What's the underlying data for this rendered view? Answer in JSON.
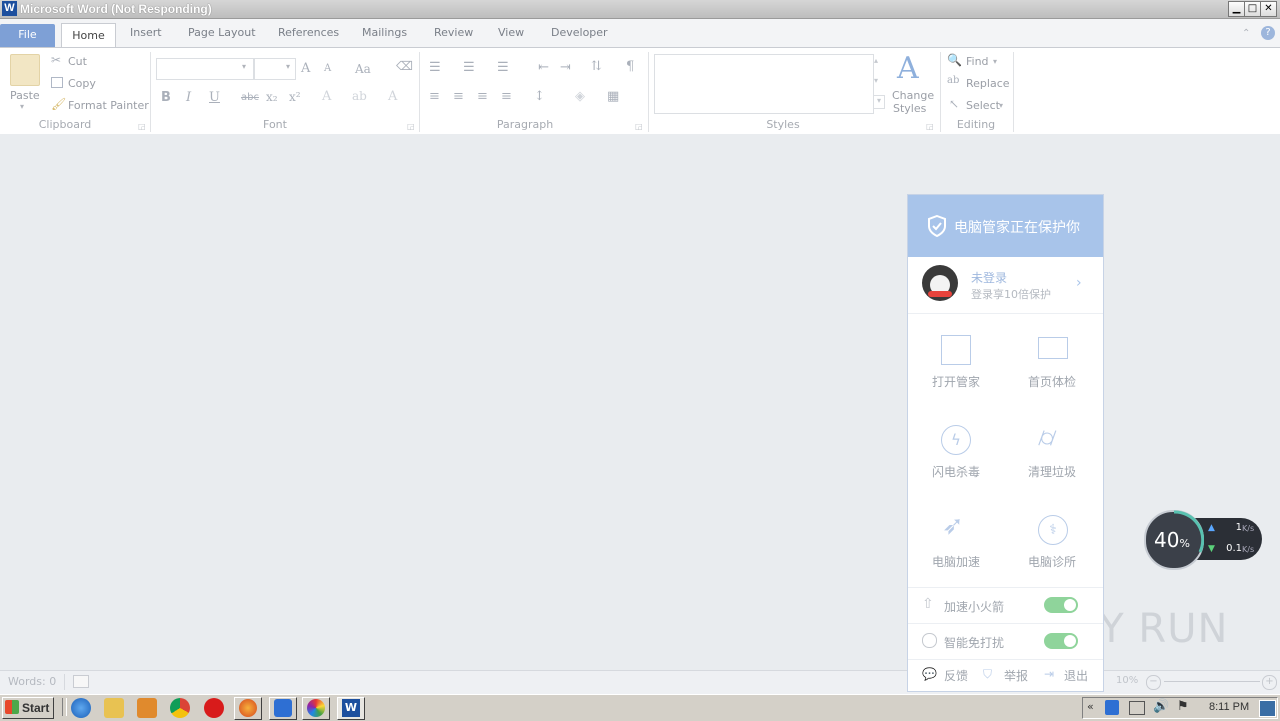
{
  "window": {
    "title": "Microsoft Word (Not Responding)",
    "app_icon_letter": "W"
  },
  "tabs": [
    "File",
    "Home",
    "Insert",
    "Page Layout",
    "References",
    "Mailings",
    "Review",
    "View",
    "Developer"
  ],
  "ribbon": {
    "clipboard": {
      "paste": "Paste",
      "cut": "Cut",
      "copy": "Copy",
      "format_painter": "Format Painter",
      "group": "Clipboard"
    },
    "font": {
      "group": "Font",
      "bold": "B",
      "italic": "I",
      "underline": "U",
      "strike": "abc",
      "sub": "x₂",
      "sup": "x²",
      "grow": "A",
      "shrink": "A",
      "case": "Aa"
    },
    "paragraph": {
      "group": "Paragraph",
      "pilcrow": "¶"
    },
    "styles": {
      "group": "Styles",
      "change_styles": "Change",
      "change_styles2": "Styles"
    },
    "editing": {
      "group": "Editing",
      "find": "Find",
      "replace": "Replace",
      "select": "Select"
    }
  },
  "status": {
    "words": "Words: 0",
    "zoom": "10%"
  },
  "popup": {
    "title": "电脑管家正在保护你",
    "user_status": "未登录",
    "user_hint": "登录享10倍保护",
    "tiles": [
      "打开管家",
      "首页体检",
      "闪电杀毒",
      "清理垃圾",
      "电脑加速",
      "电脑诊所"
    ],
    "toggles": [
      "加速小火箭",
      "智能免打扰"
    ],
    "footer": [
      "反馈",
      "举报",
      "退出"
    ]
  },
  "speed": {
    "percent": "40",
    "percent_unit": "%",
    "up": "1",
    "up_unit": "K/s",
    "down": "0.1",
    "down_unit": "K/s"
  },
  "taskbar": {
    "start": "Start",
    "clock": "8:11 PM"
  },
  "watermark": "ANY RUN"
}
